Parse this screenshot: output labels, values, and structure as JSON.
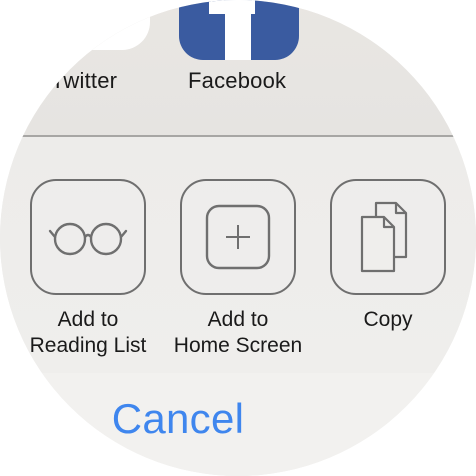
{
  "share_row": {
    "items": [
      {
        "label": "Twitter",
        "icon": "twitter-icon"
      },
      {
        "label": "Facebook",
        "icon": "facebook-icon"
      }
    ]
  },
  "actions": [
    {
      "label_line1": "Add to",
      "label_line2": "Reading List",
      "icon": "glasses-icon"
    },
    {
      "label_line1": "Add to",
      "label_line2": "Home Screen",
      "icon": "plus-square-icon"
    },
    {
      "label_line1": "Copy",
      "label_line2": "",
      "icon": "copy-documents-icon"
    }
  ],
  "cancel": {
    "label": "Cancel"
  },
  "colors": {
    "accent": "#3f86ee",
    "facebook": "#3a5ba0",
    "icon_stroke": "#6f6f6f",
    "divider": "#a7a6a4"
  }
}
